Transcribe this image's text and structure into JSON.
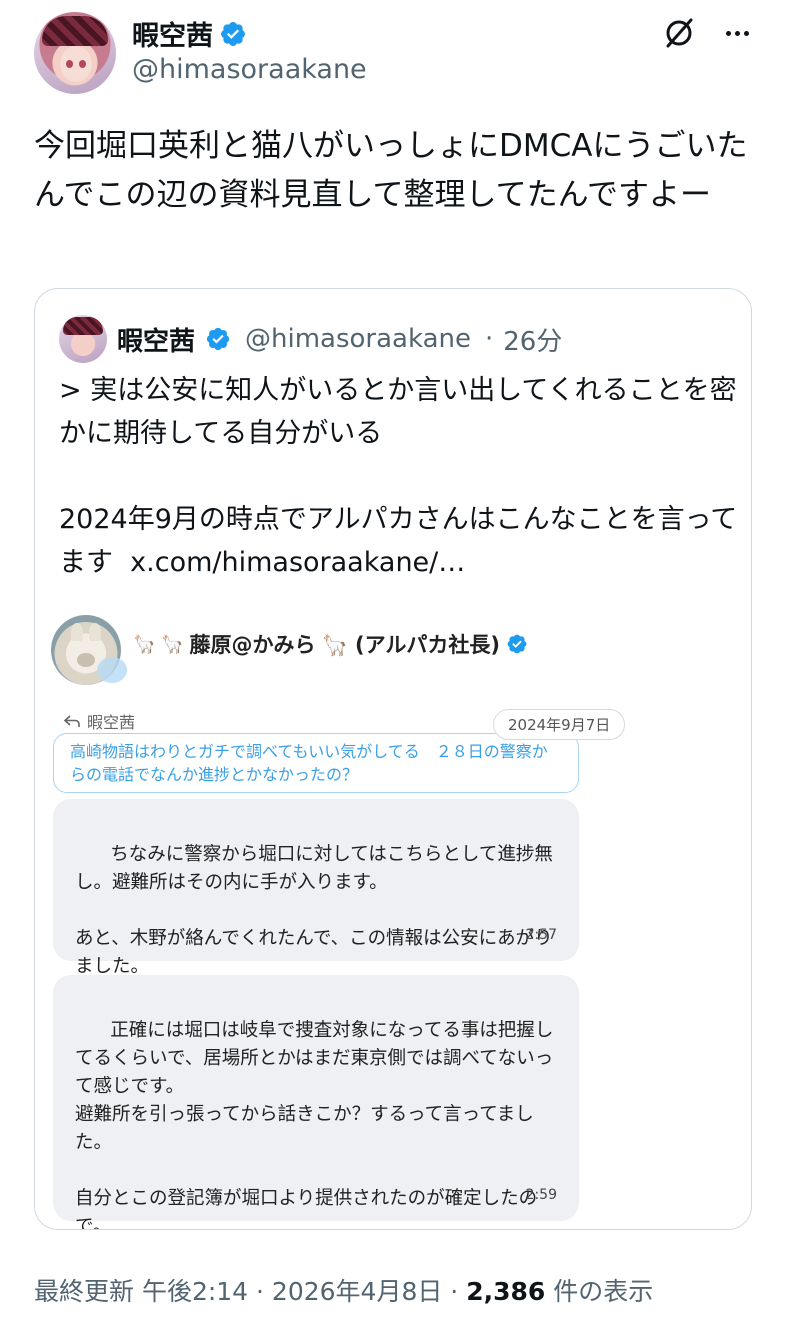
{
  "author": {
    "name": "暇空茜",
    "handle": "@himasoraakane"
  },
  "tweet": {
    "text": "今回堀口英利と猫八がいっしょにDMCAにうごいたんでこの辺の資料見直して整理してたんですよー"
  },
  "quote": {
    "name": "暇空茜",
    "handle": "@himasoraakane",
    "separator": "·",
    "time": "26分",
    "text_line1": "> 実は公安に知人がいるとか言い出してくれることを密かに期待してる自分がいる",
    "text_line2": "2024年9月の時点でアルパカさんはこんなことを言ってます",
    "link": "x.com/himasoraakane/…",
    "screenshot": {
      "sender_prefix": "🦙 🦙",
      "sender_name": "藤原@かみら",
      "sender_suffix": "🦙 (アルパカ社長)",
      "reply_to_label": "暇空茜",
      "date_pill": "2024年9月7日",
      "reply_text": "高崎物語はわりとガチで調べてもいい気がしてる　２８日の警察からの電話でなんか進捗とかなかったの？",
      "message1": "ちなみに警察から堀口に対してはこちらとして進捗無し。避難所はその内に手が入ります。\n\nあと、木野が絡んでくれたんで、この情報は公安にあがりました。",
      "message1_time": "2:57",
      "message2": "正確には堀口は岐阜で捜査対象になってる事は把握してるくらいで、居場所とかはまだ東京側では調べてないって感じです。\n避難所を引っ張ってから話きこか？するって言ってました。\n\n自分とこの登記簿が堀口より提供されたのが確定したので。",
      "message2_time": "2:59"
    }
  },
  "footer": {
    "prefix": "最終更新 午後2:14 · 2026年4月8日 · ",
    "views": "2,386",
    "suffix": " 件の表示"
  },
  "icons": {
    "verified": "verified-badge-icon",
    "grok": "grok-icon",
    "more": "more-icon",
    "reply": "reply-arrow-icon"
  },
  "colors": {
    "verified_blue": "#1d9bf0",
    "secondary_text": "#536471",
    "border": "#cfd9de"
  }
}
